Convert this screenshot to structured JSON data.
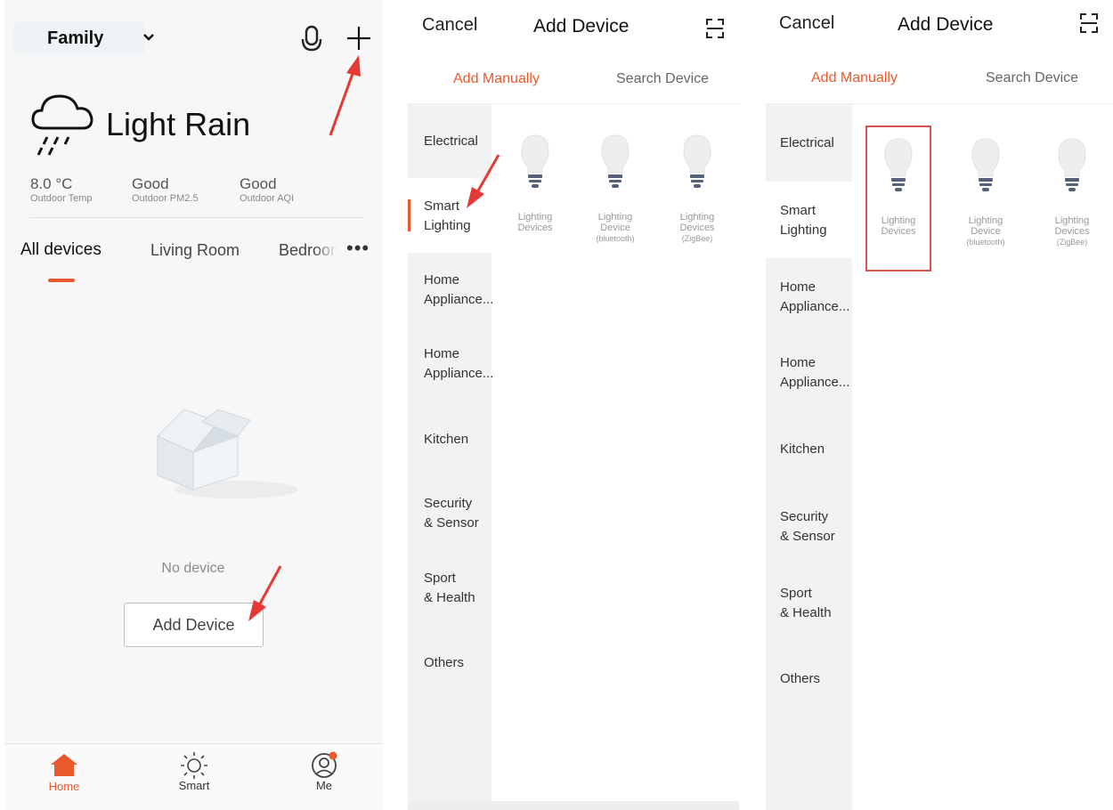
{
  "home": {
    "family_label": "Family",
    "weather": {
      "condition": "Light Rain"
    },
    "metrics": [
      {
        "value": "8.0 °C",
        "label": "Outdoor Temp"
      },
      {
        "value": "Good",
        "label": "Outdoor PM2.5"
      },
      {
        "value": "Good",
        "label": "Outdoor AQI"
      }
    ],
    "tabs": [
      "All devices",
      "Living Room",
      "Bedroom"
    ],
    "empty_text": "No device",
    "add_device_label": "Add Device",
    "tabbar": [
      {
        "label": "Home",
        "icon": "home-icon"
      },
      {
        "label": "Smart",
        "icon": "sun-icon"
      },
      {
        "label": "Me",
        "icon": "profile-icon"
      }
    ]
  },
  "add_device": {
    "cancel_label": "Cancel",
    "title": "Add Device",
    "tabs": {
      "manual": "Add Manually",
      "search": "Search Device"
    },
    "categories": [
      {
        "line1": "Electrical",
        "line2": ""
      },
      {
        "line1": "Smart",
        "line2": "Lighting"
      },
      {
        "line1": "Home",
        "line2": "Appliance..."
      },
      {
        "line1": "Home",
        "line2": "Appliance..."
      },
      {
        "line1": "Kitchen",
        "line2": ""
      },
      {
        "line1": "Security",
        "line2": "& Sensor"
      },
      {
        "line1": "Sport",
        "line2": "& Health"
      },
      {
        "line1": "Others",
        "line2": ""
      }
    ],
    "devices": [
      {
        "line1": "Lighting",
        "line2": "Devices",
        "line3": ""
      },
      {
        "line1": "Lighting",
        "line2": "Device",
        "line3": "(bluetooth)"
      },
      {
        "line1": "Lighting",
        "line2": "Devices",
        "line3": "(ZigBee)"
      }
    ]
  },
  "colors": {
    "accent": "#e9592b",
    "highlight": "#d9534f"
  }
}
